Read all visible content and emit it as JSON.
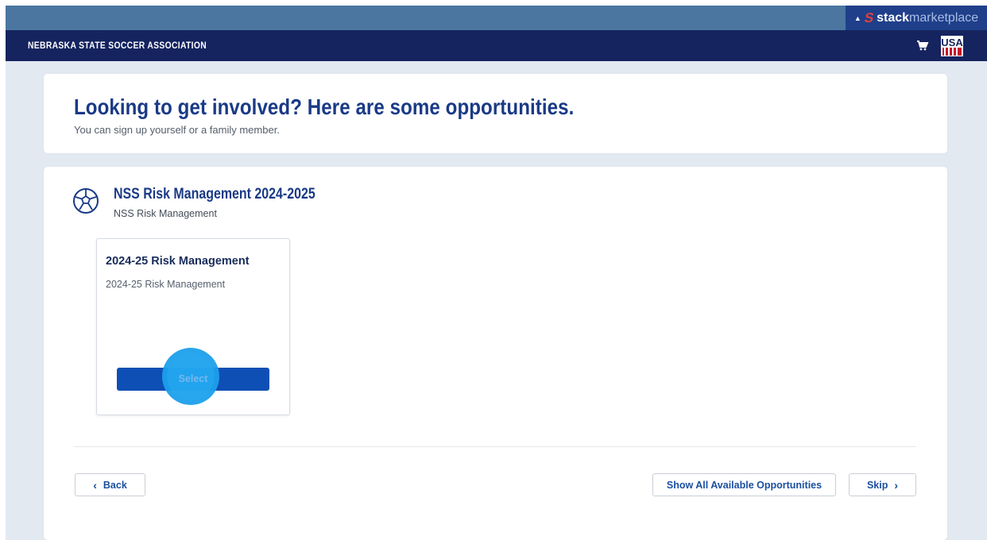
{
  "marketplace": {
    "brand_bold": "stack",
    "brand_light": "marketplace",
    "caret_icon": "caret-up-icon",
    "logo_icon": "stack-s-logo-icon"
  },
  "nav": {
    "org_name": "NEBRASKA STATE SOCCER ASSOCIATION",
    "cart_icon": "cart-icon",
    "federation_logo_text": "USA"
  },
  "header": {
    "title": "Looking to get involved? Here are some opportunities.",
    "subtitle": "You can sign up yourself or a family member."
  },
  "program": {
    "icon": "soccer-ball-icon",
    "title": "NSS Risk Management 2024-2025",
    "subtitle": "NSS Risk Management",
    "opportunities": [
      {
        "title": "2024-25 Risk Management",
        "description": "2024-25 Risk Management",
        "select_label": "Select"
      }
    ]
  },
  "footer": {
    "back_label": "Back",
    "show_all_label": "Show All Available Opportunities",
    "skip_label": "Skip"
  },
  "colors": {
    "topbar": "#4a76a0",
    "navbar": "#15245f",
    "heading": "#1a3a86",
    "primary_button": "#0e4fb5",
    "click_highlight": "#1c9feb",
    "background": "#e3e9f1"
  }
}
